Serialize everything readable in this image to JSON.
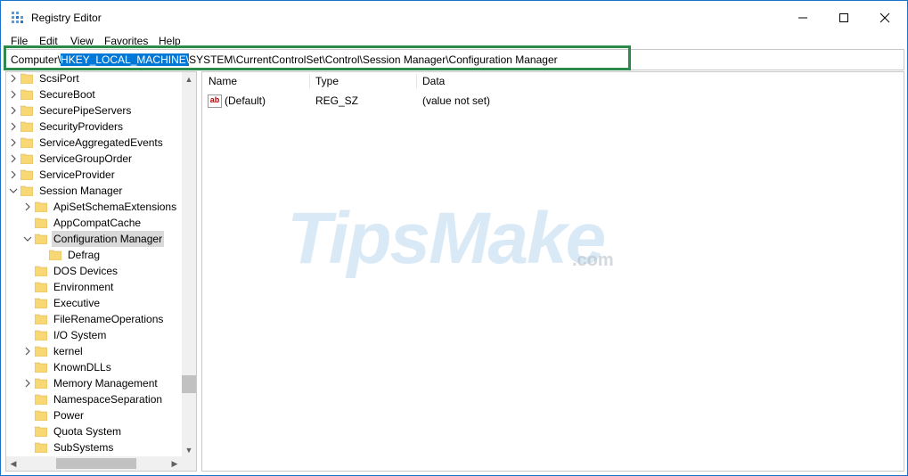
{
  "window": {
    "title": "Registry Editor"
  },
  "menu": [
    "File",
    "Edit",
    "View",
    "Favorites",
    "Help"
  ],
  "address": {
    "prefix": "Computer\\",
    "selected": "HKEY_LOCAL_MACHINE\\",
    "rest": "SYSTEM\\CurrentControlSet\\Control\\Session Manager\\Configuration Manager"
  },
  "tree": [
    {
      "label": "ScsiPort",
      "level": 0,
      "expander": "collapsed"
    },
    {
      "label": "SecureBoot",
      "level": 0,
      "expander": "collapsed"
    },
    {
      "label": "SecurePipeServers",
      "level": 0,
      "expander": "collapsed"
    },
    {
      "label": "SecurityProviders",
      "level": 0,
      "expander": "collapsed"
    },
    {
      "label": "ServiceAggregatedEvents",
      "level": 0,
      "expander": "collapsed"
    },
    {
      "label": "ServiceGroupOrder",
      "level": 0,
      "expander": "collapsed"
    },
    {
      "label": "ServiceProvider",
      "level": 0,
      "expander": "collapsed"
    },
    {
      "label": "Session Manager",
      "level": 0,
      "expander": "expanded"
    },
    {
      "label": "ApiSetSchemaExtensions",
      "level": 1,
      "expander": "collapsed"
    },
    {
      "label": "AppCompatCache",
      "level": 1,
      "expander": "none"
    },
    {
      "label": "Configuration Manager",
      "level": 1,
      "expander": "expanded",
      "selected": true
    },
    {
      "label": "Defrag",
      "level": 2,
      "expander": "none"
    },
    {
      "label": "DOS Devices",
      "level": 1,
      "expander": "none"
    },
    {
      "label": "Environment",
      "level": 1,
      "expander": "none"
    },
    {
      "label": "Executive",
      "level": 1,
      "expander": "none"
    },
    {
      "label": "FileRenameOperations",
      "level": 1,
      "expander": "none"
    },
    {
      "label": "I/O System",
      "level": 1,
      "expander": "none"
    },
    {
      "label": "kernel",
      "level": 1,
      "expander": "collapsed"
    },
    {
      "label": "KnownDLLs",
      "level": 1,
      "expander": "none"
    },
    {
      "label": "Memory Management",
      "level": 1,
      "expander": "collapsed"
    },
    {
      "label": "NamespaceSeparation",
      "level": 1,
      "expander": "none"
    },
    {
      "label": "Power",
      "level": 1,
      "expander": "none"
    },
    {
      "label": "Quota System",
      "level": 1,
      "expander": "none"
    },
    {
      "label": "SubSystems",
      "level": 1,
      "expander": "none"
    }
  ],
  "columns": {
    "name": "Name",
    "type": "Type",
    "data": "Data"
  },
  "values": [
    {
      "name": "(Default)",
      "type": "REG_SZ",
      "data": "(value not set)",
      "icon": "ab"
    }
  ],
  "watermark": {
    "brand": "TipsMake",
    "domain": ".com"
  },
  "colors": {
    "selection": "#0078d7",
    "highlight": "#2c8a4a",
    "folder": "#f8d775"
  }
}
